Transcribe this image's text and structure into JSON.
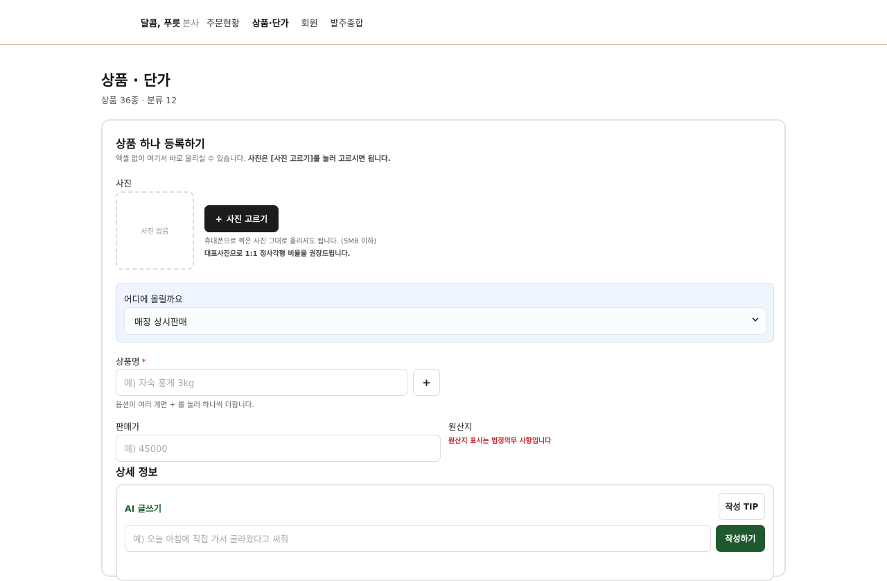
{
  "nav": {
    "brand": "달콤, 푸릇",
    "brand_sub": "본사",
    "items": [
      {
        "label": "주문현황",
        "active": false
      },
      {
        "label": "상품·단가",
        "active": true
      },
      {
        "label": "회원",
        "active": false
      },
      {
        "label": "발주종합",
        "active": false
      }
    ]
  },
  "header": {
    "title": "상품 · 단가",
    "meta": "상품 36종 · 분류 12"
  },
  "form": {
    "title": "상품 하나 등록하기",
    "desc_plain": "엑셀 없이 여기서 바로 올리실 수 있습니다. ",
    "desc_bold": "사진은 [사진 고르기]를 눌러 고르시면 됩니다.",
    "photo": {
      "label": "사진",
      "empty": "사진 없음",
      "pick_icon": "+",
      "pick_label": "사진 고르기",
      "hint": "휴대폰으로 찍은 사진 그대로 올리셔도 됩니다. (5MB 이하)",
      "hint_bold": "대표사진으로 1:1 정사각형 비율을 권장드립니다."
    },
    "where": {
      "label": "어디에 올릴까요",
      "selected": "매장 상시판매"
    },
    "name": {
      "label": "상품명",
      "required": "*",
      "placeholder": "예) 자숙 홍게 3kg",
      "plus": "+",
      "hint": "옵션이 여러 개면 + 를 눌러 하나씩 더합니다."
    },
    "price": {
      "label": "판매가",
      "placeholder": "예) 45000"
    },
    "origin": {
      "label": "원산지",
      "warning": "원산지 표시는 법정의무 사항입니다"
    },
    "detail": {
      "title": "상세 정보",
      "ai_title": "AI 글쓰기",
      "tip": "작성 TIP",
      "placeholder": "예) 오늘 아침에 직접 가서 골라왔다고 써줘",
      "write": "작성하기"
    }
  }
}
